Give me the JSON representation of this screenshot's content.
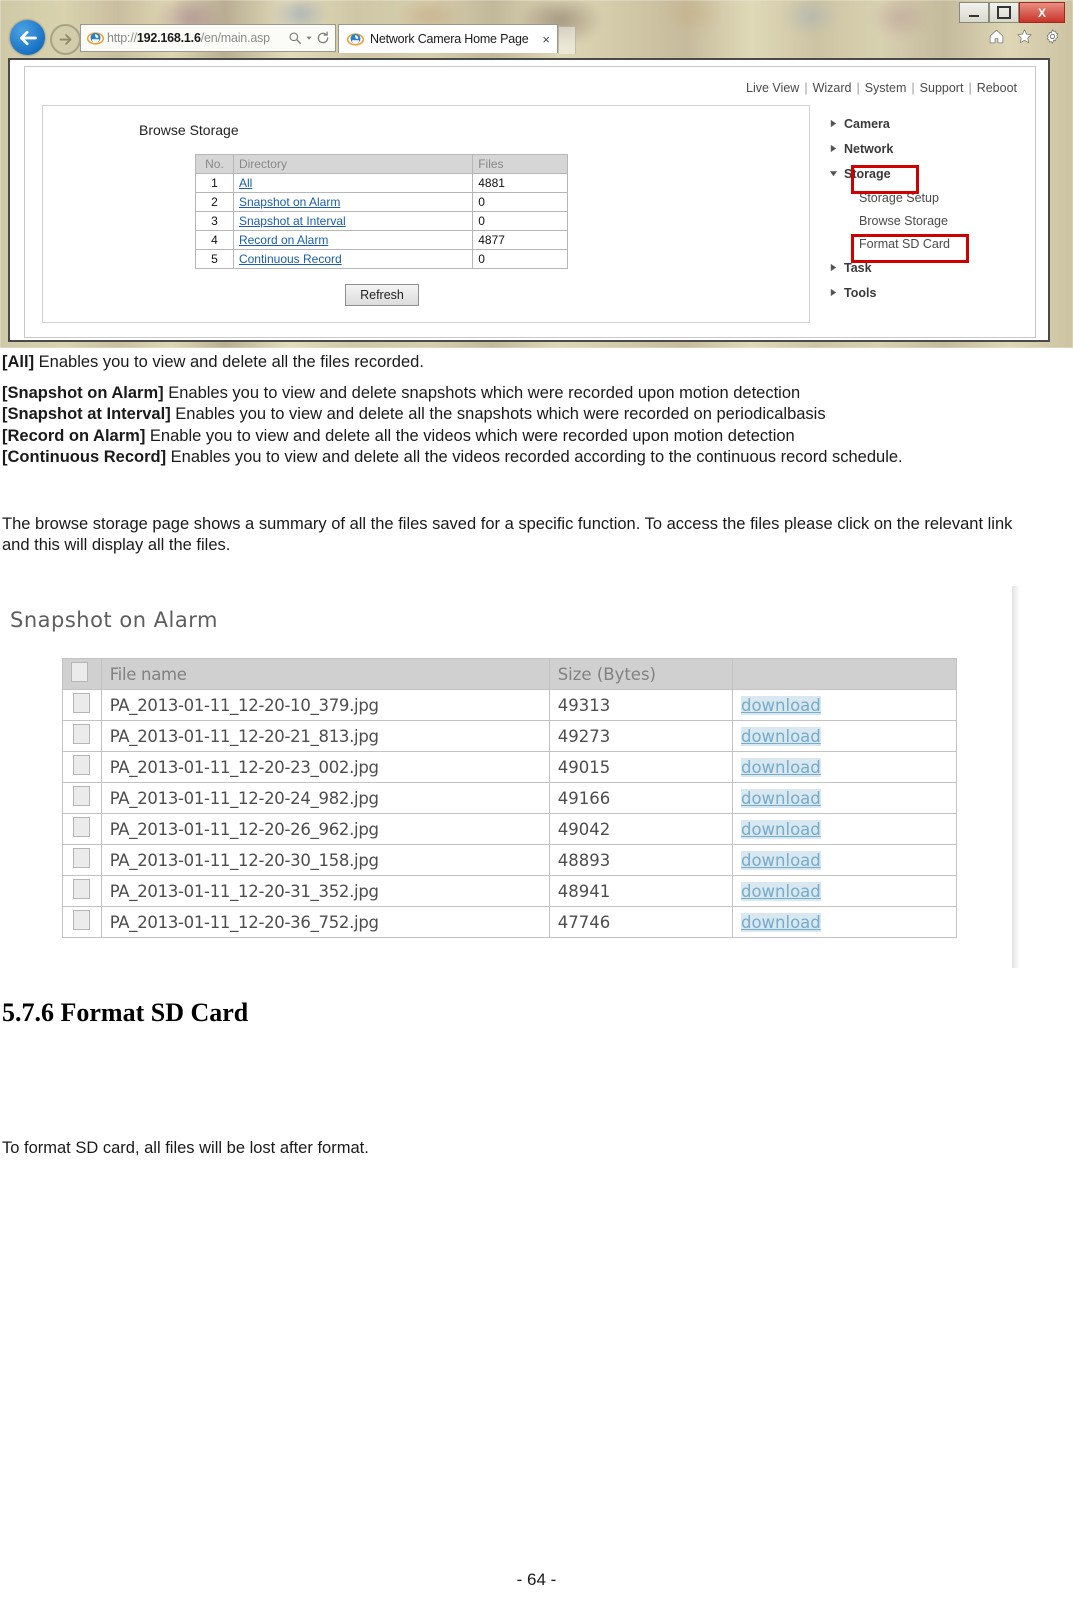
{
  "browser": {
    "window_controls": {
      "minimize": "minimize-button",
      "maximize": "maximize-button",
      "close_label": "X"
    },
    "url": "http://192.168.1.6/en/main.asp",
    "url_scheme": "http://",
    "url_host": "192.168.1.6",
    "url_path": "/en/main.asp",
    "tab_title": "Network Camera Home Page",
    "tab_close_label": "×",
    "toolbar_icons": [
      "home-icon",
      "favorites-star-icon",
      "settings-gear-icon"
    ],
    "nav_icons": [
      "back-arrow-icon",
      "forward-arrow-icon"
    ],
    "address_icons": [
      "search-magnifier-icon",
      "dropdown-caret-icon",
      "refresh-icon"
    ]
  },
  "camera_ui": {
    "topnav": [
      {
        "label": "Live View"
      },
      {
        "label": "Wizard"
      },
      {
        "label": "System"
      },
      {
        "label": "Support"
      },
      {
        "label": "Reboot"
      }
    ],
    "topnav_separator": "|",
    "panel_title": "Browse Storage",
    "table": {
      "headers": [
        "No.",
        "Directory",
        "Files"
      ],
      "rows": [
        {
          "no": "1",
          "directory": "All",
          "files": "4881"
        },
        {
          "no": "2",
          "directory": "Snapshot on Alarm",
          "files": "0"
        },
        {
          "no": "3",
          "directory": "Snapshot at Interval",
          "files": "0"
        },
        {
          "no": "4",
          "directory": "Record on Alarm",
          "files": "4877"
        },
        {
          "no": "5",
          "directory": "Continuous Record",
          "files": "0"
        }
      ]
    },
    "refresh_button": "Refresh",
    "sidemenu": {
      "items": [
        {
          "label": "Camera",
          "expanded": false
        },
        {
          "label": "Network",
          "expanded": false
        },
        {
          "label": "Storage",
          "expanded": true,
          "highlighted": true
        },
        {
          "label": "Task",
          "expanded": false
        },
        {
          "label": "Tools",
          "expanded": false
        }
      ],
      "storage_children": [
        {
          "label": "Storage Setup",
          "highlighted": false
        },
        {
          "label": "Browse Storage",
          "highlighted": true
        },
        {
          "label": "Format SD Card",
          "highlighted": false
        }
      ],
      "highlight_color": "#d00000"
    }
  },
  "doc": {
    "para_all_bold": "[All]",
    "para_all_rest": " Enables you to view and delete all the files recorded.",
    "defs": [
      {
        "term": "[Snapshot on Alarm]",
        "desc": " Enables you to view and delete snapshots which were recorded upon motion detection"
      },
      {
        "term": "[Snapshot at Interval]",
        "desc": " Enables you to view and delete all the snapshots which were recorded on periodicalbasis"
      },
      {
        "term": "[Record on Alarm]",
        "desc": " Enable you to view and delete all the videos which were recorded upon motion detection"
      },
      {
        "term": "[Continuous Record]",
        "desc": " Enables you to view and delete all the videos recorded according to the continuous record schedule."
      }
    ],
    "para_browse": "The browse storage page shows a summary of all the files saved for a specific function. To access the files please click on the relevant link and this will display all the files.",
    "section_heading": "5.7.6 Format SD Card",
    "para_format": "To format SD card, all files will be lost after format.",
    "page_number": "- 64 -"
  },
  "file_list": {
    "title": "Snapshot on Alarm",
    "headers": [
      "",
      "File name",
      "Size (Bytes)",
      ""
    ],
    "download_label": "download",
    "rows": [
      {
        "name": "PA_2013-01-11_12-20-10_379.jpg",
        "size": "49313"
      },
      {
        "name": "PA_2013-01-11_12-20-21_813.jpg",
        "size": "49273"
      },
      {
        "name": "PA_2013-01-11_12-20-23_002.jpg",
        "size": "49015"
      },
      {
        "name": "PA_2013-01-11_12-20-24_982.jpg",
        "size": "49166"
      },
      {
        "name": "PA_2013-01-11_12-20-26_962.jpg",
        "size": "49042"
      },
      {
        "name": "PA_2013-01-11_12-20-30_158.jpg",
        "size": "48893"
      },
      {
        "name": "PA_2013-01-11_12-20-31_352.jpg",
        "size": "48941"
      },
      {
        "name": "PA_2013-01-11_12-20-36_752.jpg",
        "size": "47746"
      }
    ]
  }
}
